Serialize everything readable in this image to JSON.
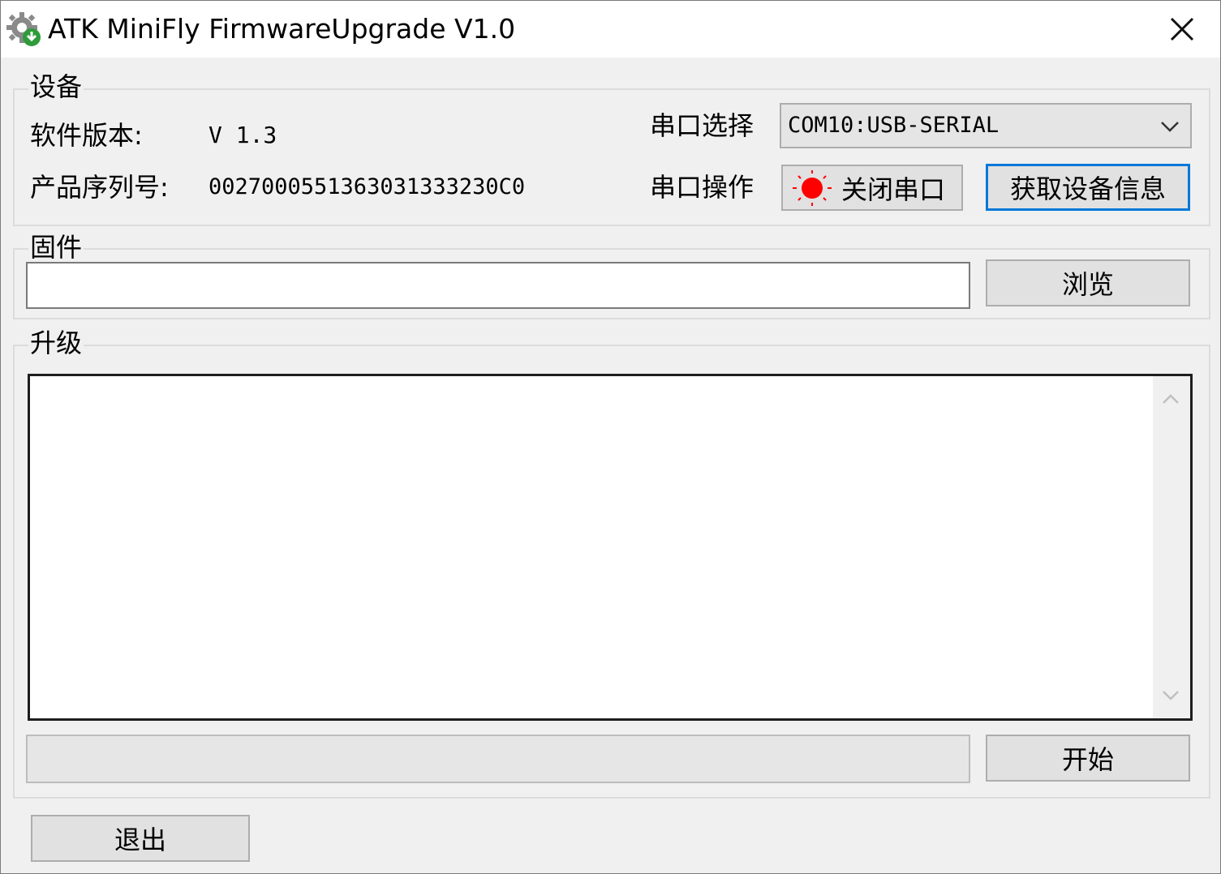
{
  "window": {
    "title": "ATK MiniFly FirmwareUpgrade V1.0"
  },
  "device_group": {
    "label": "设备",
    "software_version_label": "软件版本:",
    "software_version_value": "V 1.3",
    "serial_number_label": "产品序列号:",
    "serial_number_value": "0027000551363031333230C0",
    "port_select_label": "串口选择",
    "port_select_value": "COM10:USB-SERIAL",
    "port_op_label": "串口操作",
    "close_port_button": "关闭串口",
    "get_info_button": "获取设备信息",
    "port_status_color": "#ff0000"
  },
  "firmware_group": {
    "label": "固件",
    "path_value": "",
    "browse_button": "浏览"
  },
  "upgrade_group": {
    "label": "升级",
    "log_text": "",
    "progress": 0,
    "start_button": "开始"
  },
  "footer": {
    "exit_button": "退出"
  }
}
